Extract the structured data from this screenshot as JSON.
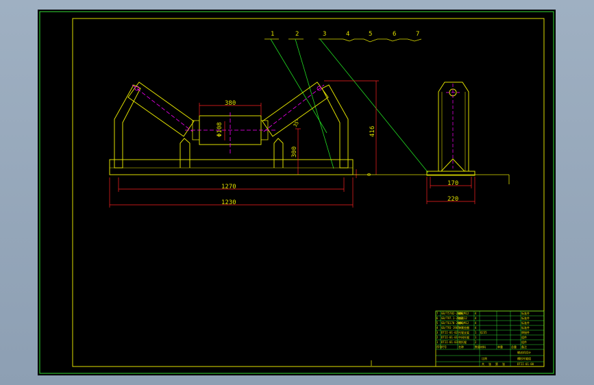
{
  "drawing": {
    "part_leaders": [
      "1",
      "2",
      "3",
      "4",
      "5",
      "6",
      "7"
    ],
    "dimensions": {
      "roller_length": "380",
      "roller_diameter": "Φ108",
      "trough_angle": "35°",
      "support_height": "300",
      "total_height": "416",
      "base_offset": "0",
      "bolt_spacing": "1270",
      "overall_length": "1230",
      "side_bolt_spacing": "170",
      "side_base_width": "220"
    }
  },
  "title_block": {
    "part_rows": [
      {
        "no": "7",
        "code": "GB/T5782-2000",
        "name": "螺栓M12",
        "qty": "4",
        "material": "",
        "note": "标准件"
      },
      {
        "no": "6",
        "code": "GB/T97.1-2002",
        "name": "垫圈12",
        "qty": "4",
        "material": "",
        "note": "标准件"
      },
      {
        "no": "5",
        "code": "GB/T6170-2000",
        "name": "螺母M12",
        "qty": "4",
        "material": "",
        "note": "标准件"
      },
      {
        "no": "4",
        "code": "GB/T93-1987",
        "name": "弹簧垫圈",
        "qty": "4",
        "material": "",
        "note": "标准件"
      },
      {
        "no": "3",
        "code": "DTII-01-02",
        "name": "托辊支架",
        "qty": "1",
        "material": "Q235",
        "note": "焊接件"
      },
      {
        "no": "2",
        "code": "DTII-01-01",
        "name": "中间托辊",
        "qty": "1",
        "material": "",
        "note": "组件"
      },
      {
        "no": "1",
        "code": "DTII-01-03",
        "name": "侧托辊",
        "qty": "2",
        "material": "",
        "note": "组件"
      }
    ],
    "header_cells": [
      "序号",
      "代号",
      "名称",
      "数量",
      "材料",
      "单重",
      "总重",
      "备注"
    ],
    "drawing_title": "槽形托辊组",
    "drawing_number": "DTII-01-00",
    "company": "输送机设计",
    "scale_label": "比例",
    "sheet_labels": [
      "共",
      "张",
      "第",
      "张"
    ]
  }
}
